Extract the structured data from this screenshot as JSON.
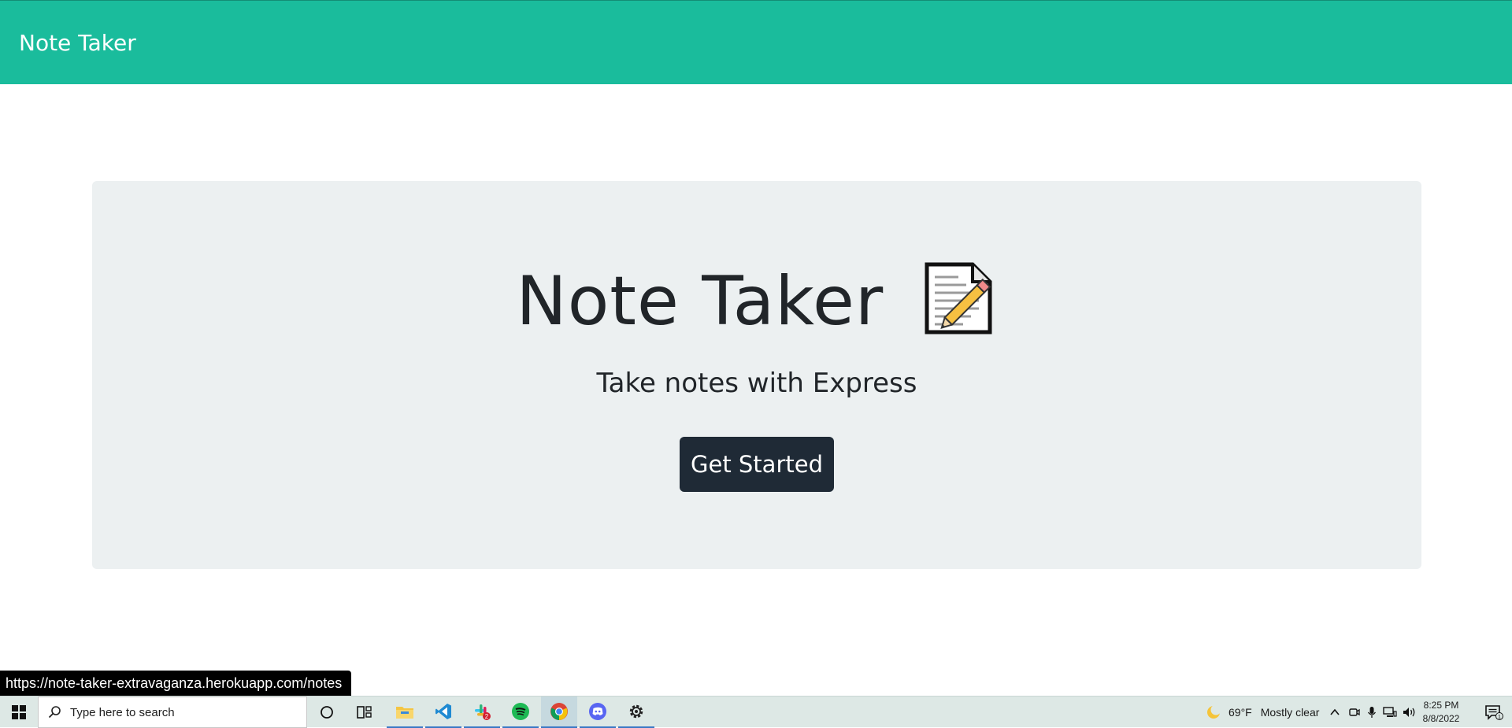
{
  "navbar": {
    "brand": "Note Taker"
  },
  "hero": {
    "title": "Note Taker",
    "title_icon": "memo-icon",
    "subtitle": "Take notes with Express",
    "cta_label": "Get Started"
  },
  "status_bar": {
    "url": "https://note-taker-extravaganza.herokuapp.com/notes"
  },
  "taskbar": {
    "search_placeholder": "Type here to search",
    "apps": [
      {
        "name": "file-explorer-icon"
      },
      {
        "name": "vscode-icon"
      },
      {
        "name": "slack-icon",
        "badge": "2"
      },
      {
        "name": "spotify-icon"
      },
      {
        "name": "chrome-icon"
      },
      {
        "name": "discord-icon"
      },
      {
        "name": "settings-icon"
      }
    ],
    "weather": {
      "temp": "69°F",
      "condition": "Mostly clear"
    },
    "clock": {
      "time": "8:25 PM",
      "date": "8/8/2022"
    },
    "notification_count": "1"
  },
  "colors": {
    "navbar": "#1abc9c",
    "jumbotron": "#ecf0f1",
    "button": "#1f2a36",
    "text": "#212529"
  }
}
